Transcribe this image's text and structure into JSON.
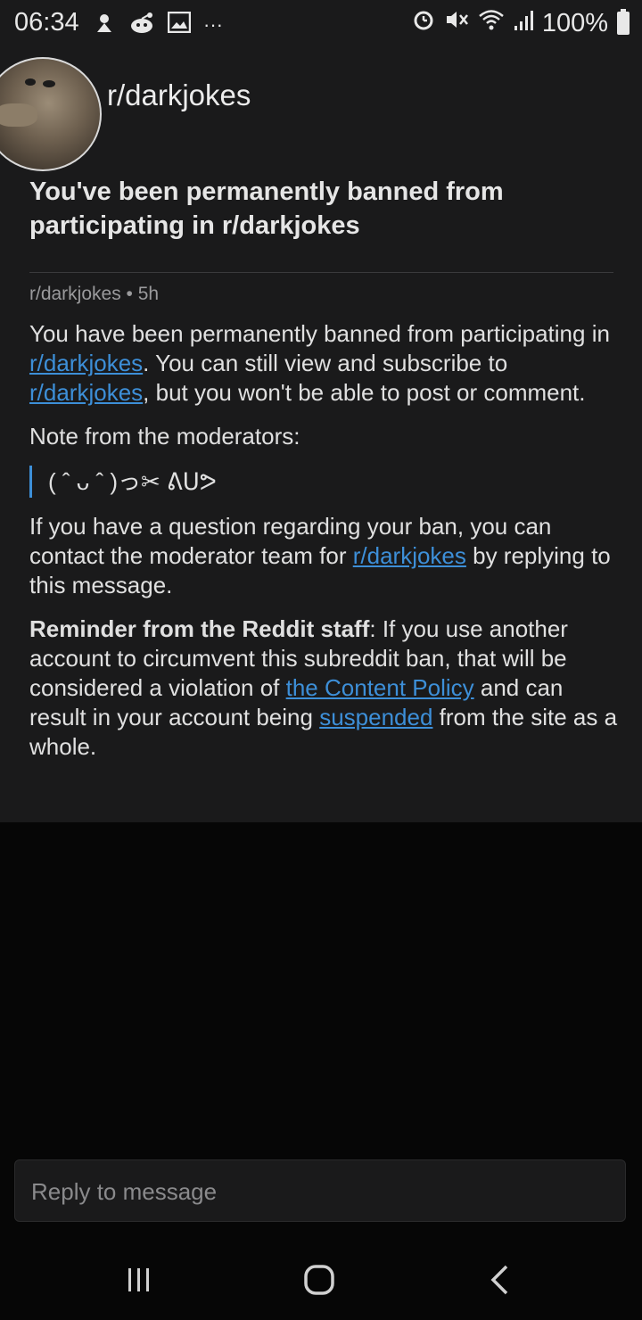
{
  "status_bar": {
    "time": "06:34",
    "battery": "100%",
    "left_icons": [
      "notification-icon",
      "reddit-icon",
      "gallery-icon",
      "more-icon"
    ],
    "right_icons": [
      "alarm-icon",
      "mute-icon",
      "wifi-icon",
      "signal-icon",
      "battery-icon"
    ],
    "more": "···"
  },
  "message": {
    "subreddit": "r/darkjokes",
    "subject": "You've been permanently banned from participating in r/darkjokes",
    "meta": "r/darkjokes • 5h",
    "p1_a": "You have been permanently banned from participating in ",
    "p1_link1": "r/darkjokes",
    "p1_b": ". You can still view and subscribe to ",
    "p1_link2": "r/darkjokes",
    "p1_c": ", but you won't be able to post or comment.",
    "note_label": "Note from the moderators:",
    "quote": "( ˆ ᴗ ˆ )っ✂ ᕕᑌᕗ",
    "p3_a": "If you have a question regarding your ban, you can contact the moderator team for ",
    "p3_link": "r/darkjokes",
    "p3_b": " by replying to this message.",
    "p4_bold": "Reminder from the Reddit staff",
    "p4_a": ": If you use another account to circumvent this subreddit ban, that will be considered a violation of ",
    "p4_link1": "the Content Policy",
    "p4_b": " and can result in your account being ",
    "p4_link2": "suspended",
    "p4_c": " from the site as a whole."
  },
  "reply": {
    "placeholder": "Reply to message"
  },
  "navbar": {
    "buttons": [
      "recent-apps",
      "home",
      "back"
    ]
  },
  "colors": {
    "background": "#060606",
    "card": "#1a1a1b",
    "link": "#3d8fd8",
    "text": "#e0e0e0"
  }
}
